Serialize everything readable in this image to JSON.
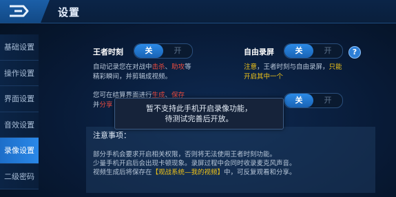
{
  "header": {
    "title": "设置"
  },
  "sidebar": {
    "items": [
      {
        "label": "基础设置"
      },
      {
        "label": "操作设置"
      },
      {
        "label": "界面设置"
      },
      {
        "label": "音效设置"
      },
      {
        "label": "录像设置"
      },
      {
        "label": "二级密码"
      }
    ],
    "active_index": 4
  },
  "king_moment": {
    "label": "王者时刻",
    "toggle_on": "关",
    "toggle_off": "开",
    "desc_line1_a": "自动记录您在对战中",
    "desc_line1_hl1": "击杀",
    "desc_line1_sep": "、",
    "desc_line1_hl2": "助攻",
    "desc_line1_b": "等",
    "desc_line2": "精彩瞬间，并剪辑成视频。",
    "desc2_line1_a": "您可在结算界面进行",
    "desc2_line1_hl1": "生成",
    "desc2_line1_sep": "、",
    "desc2_line1_hl2": "保存",
    "desc2_line2_a": "并",
    "desc2_line2_hl": "分享"
  },
  "free_record": {
    "label": "自由录屏",
    "toggle_on": "关",
    "toggle_off": "开",
    "note_line1_a": "注意",
    "note_line1_b": "，王者时刻与自由录屏，",
    "note_line1_c": "只能",
    "note_line2": "开启其中一个",
    "help_symbol": "?"
  },
  "third_toggle": {
    "toggle_on": "关",
    "toggle_off": "开"
  },
  "popup": {
    "line1": "暂不支持此手机开启录像功能，",
    "line2": "待测试完善后开放。"
  },
  "notes": {
    "title": "注意事项：",
    "line1": "部分手机会要求开启相关权限，否则将无法使用王者时刻功能。",
    "line2": "少量手机开启后会出现卡顿现象。录屏过程中会同时收录麦克风声音。",
    "line3_a": "视频生成后将保存在",
    "line3_hl": "【观战系统—我的视频】",
    "line3_b": "中，可反复观看和分享。"
  }
}
